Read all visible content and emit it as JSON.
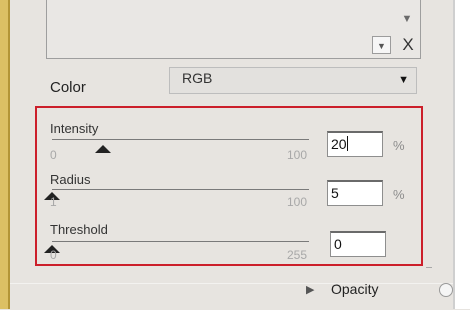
{
  "list": {
    "dropdown_glyph": "▼",
    "clear_label": "X"
  },
  "color": {
    "label": "Color",
    "value": "RGB",
    "caret": "▼"
  },
  "sliders": [
    {
      "title": "Intensity",
      "min": "0",
      "max": "100",
      "value": "20",
      "unit": "%",
      "level": 0.2
    },
    {
      "title": "Radius",
      "min": "1",
      "max": "100",
      "value": "5",
      "unit": "%",
      "level": 0.0
    },
    {
      "title": "Threshold",
      "min": "0",
      "max": "255",
      "value": "0",
      "unit": "",
      "level": 0.0
    }
  ],
  "footer": {
    "opacity_label": "Opacity",
    "expand_glyph": "▶"
  },
  "colors": {
    "highlight": "#cc1f2a",
    "frame": "#dcc064"
  }
}
